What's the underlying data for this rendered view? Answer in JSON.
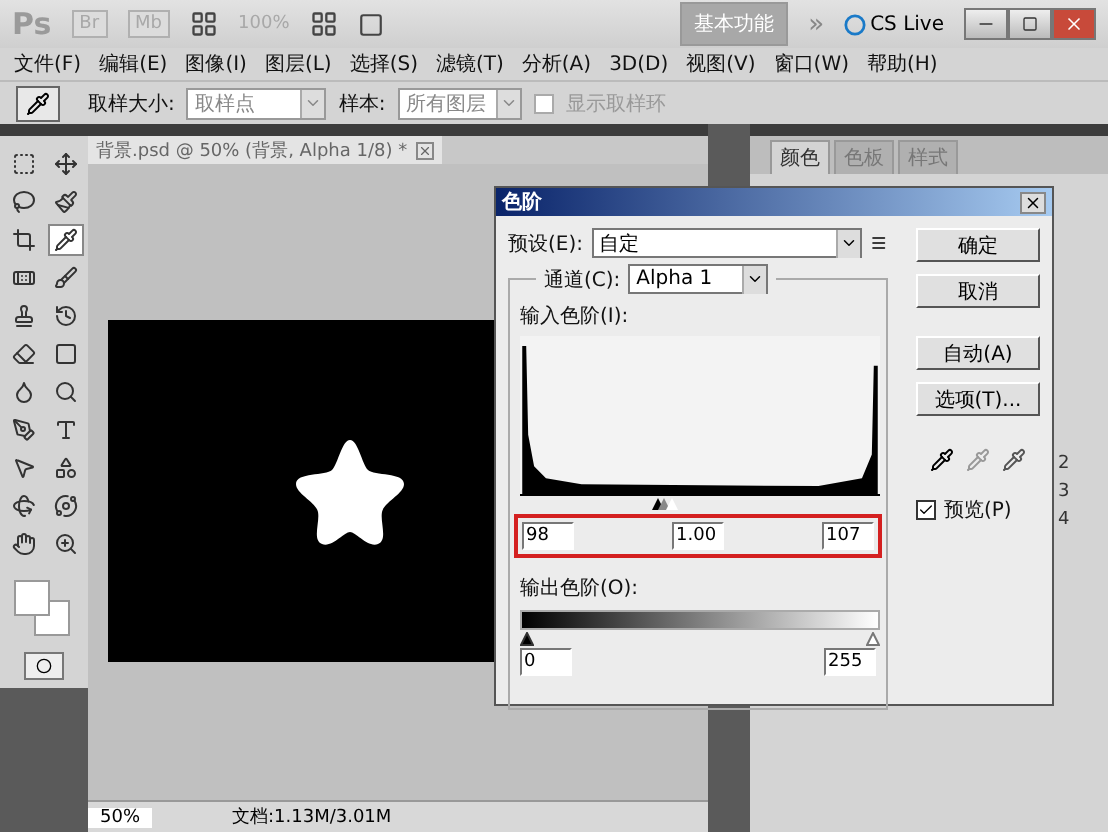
{
  "app_bar": {
    "logo": "Ps",
    "launchers": [
      "Br",
      "Mb"
    ],
    "zoom": "100%",
    "workspace": "基本功能",
    "overflow": "»",
    "cs_live": "CS Live"
  },
  "menu": [
    "文件(F)",
    "编辑(E)",
    "图像(I)",
    "图层(L)",
    "选择(S)",
    "滤镜(T)",
    "分析(A)",
    "3D(D)",
    "视图(V)",
    "窗口(W)",
    "帮助(H)"
  ],
  "options_bar": {
    "sample_size_label": "取样大小:",
    "sample_size": "取样点",
    "sample_label": "样本:",
    "sample": "所有图层",
    "show_ring": {
      "label": "显示取样环",
      "checked": false,
      "disabled": true
    }
  },
  "document": {
    "tab": "背景.psd @ 50% (背景, Alpha 1/8) *",
    "zoom": "50%",
    "doc_size": "文档:1.13M/3.01M"
  },
  "tools": [
    {
      "kind": "marquee",
      "selected": false
    },
    {
      "kind": "move",
      "selected": false
    },
    {
      "kind": "lasso",
      "selected": false
    },
    {
      "kind": "quick-select",
      "selected": false
    },
    {
      "kind": "crop",
      "selected": false
    },
    {
      "kind": "eyedropper",
      "selected": true
    },
    {
      "kind": "healing",
      "selected": false
    },
    {
      "kind": "brush",
      "selected": false
    },
    {
      "kind": "stamp",
      "selected": false
    },
    {
      "kind": "history-brush",
      "selected": false
    },
    {
      "kind": "eraser",
      "selected": false
    },
    {
      "kind": "gradient",
      "selected": false
    },
    {
      "kind": "blur",
      "selected": false
    },
    {
      "kind": "dodge",
      "selected": false
    },
    {
      "kind": "pen",
      "selected": false
    },
    {
      "kind": "type",
      "selected": false
    },
    {
      "kind": "path-select",
      "selected": false
    },
    {
      "kind": "shape",
      "selected": false
    },
    {
      "kind": "rotate-3d",
      "selected": false
    },
    {
      "kind": "orbit-3d",
      "selected": false
    },
    {
      "kind": "hand",
      "selected": false
    },
    {
      "kind": "zoom",
      "selected": false
    }
  ],
  "panel": {
    "tabs": [
      {
        "label": "颜色",
        "selected": true
      },
      {
        "label": "色板",
        "selected": false
      },
      {
        "label": "样式",
        "selected": false
      }
    ],
    "rows": [
      "2",
      "3",
      "4"
    ]
  },
  "dialog": {
    "title": "色阶",
    "preset_label": "预设(E):",
    "preset": "自定",
    "channel_label": "通道(C):",
    "channel": "Alpha 1",
    "input_label": "输入色阶(I):",
    "input_values": [
      "98",
      "1.00",
      "107"
    ],
    "output_label": "输出色阶(O):",
    "output_values": [
      "0",
      "255"
    ],
    "buttons": [
      "确定",
      "取消",
      "自动(A)",
      "选项(T)..."
    ],
    "preview": {
      "label": "预览(P)",
      "checked": true
    }
  }
}
